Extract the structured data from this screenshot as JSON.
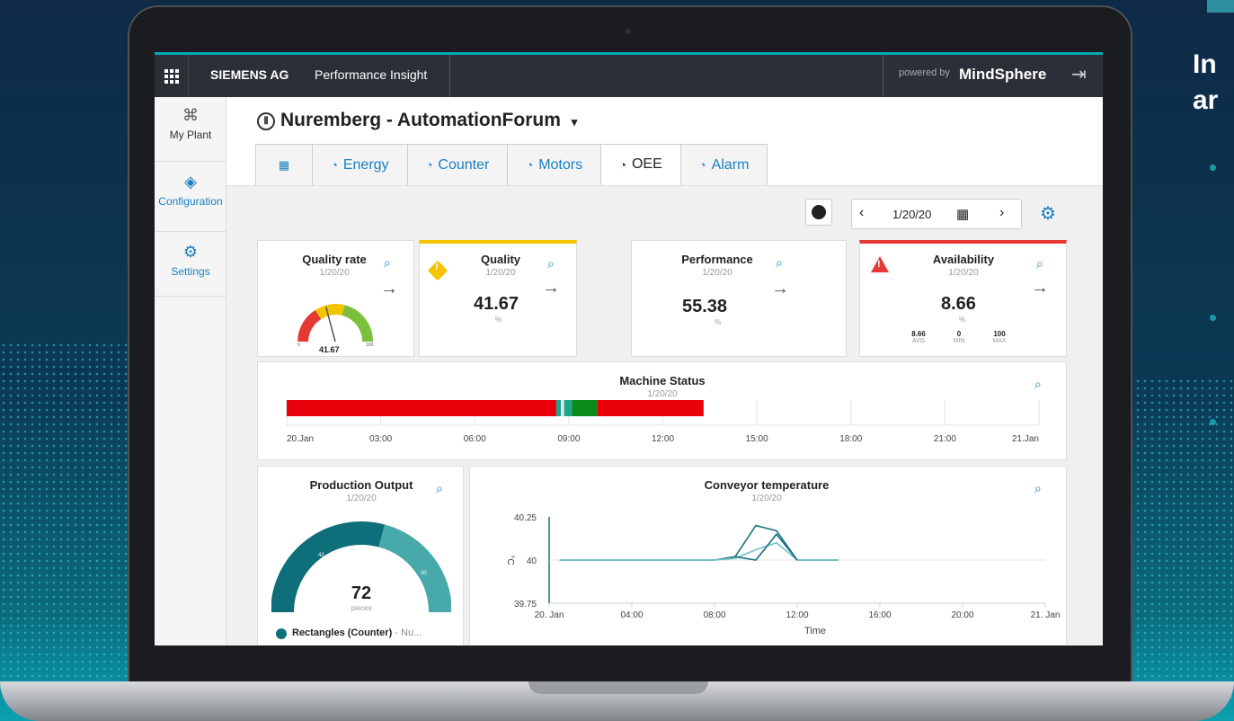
{
  "background": {
    "side_heading": "In\nar",
    "accent": "#00aab9"
  },
  "topbar": {
    "company": "SIEMENS AG",
    "app_name": "Performance Insight",
    "powered_by": "powered by",
    "brand": "MindSphere",
    "logout_icon": "logout-icon"
  },
  "sidebar": {
    "items": [
      {
        "label": "My Plant",
        "icon": "plant-icon"
      },
      {
        "label": "Configuration",
        "icon": "configuration-icon"
      },
      {
        "label": "Settings",
        "icon": "gear-icon"
      }
    ]
  },
  "header": {
    "title": "Nuremberg - AutomationForum",
    "dropdown_glyph": "▾"
  },
  "tabs": [
    {
      "label": "",
      "icon": "grid-icon"
    },
    {
      "label": "Energy",
      "icon": "gauge-icon"
    },
    {
      "label": "Counter",
      "icon": "gauge-icon"
    },
    {
      "label": "Motors",
      "icon": "gauge-icon"
    },
    {
      "label": "OEE",
      "icon": "gauge-icon",
      "active": true
    },
    {
      "label": "Alarm",
      "icon": "gauge-icon"
    }
  ],
  "toolbar": {
    "date": "1/20/20"
  },
  "kpis": {
    "quality_rate": {
      "title": "Quality rate",
      "date": "1/20/20",
      "value": "41.67",
      "unit": "%",
      "gauge_min": "0",
      "gauge_max": "100",
      "fraction": 0.4167
    },
    "quality": {
      "title": "Quality",
      "date": "1/20/20",
      "value": "41.67",
      "unit": "%",
      "status_color": "#f5c400"
    },
    "performance": {
      "title": "Performance",
      "date": "1/20/20",
      "value": "55.38",
      "unit": "%"
    },
    "availability": {
      "title": "Availability",
      "date": "1/20/20",
      "value": "8.66",
      "unit": "%",
      "status_color": "#e53935",
      "avg": "8.66",
      "avg_label": "AVG",
      "min": "0",
      "min_label": "MIN",
      "max": "100",
      "max_label": "MAX"
    }
  },
  "machine_status": {
    "title": "Machine Status",
    "date": "1/20/20",
    "ticks": [
      "20.Jan",
      "03:00",
      "06:00",
      "09:00",
      "12:00",
      "15:00",
      "18:00",
      "21:00",
      "21.Jan"
    ],
    "segments": [
      {
        "start_h": 0,
        "end_h": 8.6,
        "color": "#e8000b"
      },
      {
        "start_h": 8.6,
        "end_h": 8.75,
        "color": "#1fa38a"
      },
      {
        "start_h": 8.75,
        "end_h": 8.85,
        "color": "#d7efe8"
      },
      {
        "start_h": 8.85,
        "end_h": 9.1,
        "color": "#1fa38a"
      },
      {
        "start_h": 9.1,
        "end_h": 9.9,
        "color": "#0a8a1a"
      },
      {
        "start_h": 9.9,
        "end_h": 13.3,
        "color": "#e8000b"
      }
    ],
    "range_h": 24
  },
  "production_output": {
    "title": "Production Output",
    "date": "1/20/20",
    "value": "72",
    "unit": "pieces",
    "seg_a_label": "42",
    "seg_b_label": "30",
    "legend_name": "Rectangles (Counter)",
    "legend_suffix": " - Nu...",
    "colors": [
      "#0e6e7a",
      "#47a9a9"
    ]
  },
  "chart_data": {
    "type": "line",
    "title": "Conveyor temperature",
    "subtitle": "1/20/20",
    "xlabel": "Time",
    "ylabel": "°C",
    "yticks": [
      "40.25",
      "40",
      "39.75"
    ],
    "ylim": [
      39.75,
      40.25
    ],
    "xticks": [
      "20. Jan",
      "04:00",
      "08:00",
      "12:00",
      "16:00",
      "20:00",
      "21. Jan"
    ],
    "xlim_h": [
      0,
      24
    ],
    "series": [
      {
        "color": "#1b6f7f",
        "x": [
          0.5,
          8,
          9,
          10,
          11,
          12,
          14
        ],
        "y": [
          40,
          40,
          40.02,
          40.2,
          40.17,
          40,
          40
        ]
      },
      {
        "color": "#6cc1c6",
        "x": [
          0.5,
          8,
          9,
          10,
          11,
          12,
          14
        ],
        "y": [
          40,
          40,
          40.01,
          40.06,
          40.1,
          40,
          40
        ]
      },
      {
        "color": "#1b6f7f",
        "x": [
          9,
          10,
          11,
          12
        ],
        "y": [
          40.02,
          40,
          40.15,
          40
        ]
      }
    ]
  }
}
